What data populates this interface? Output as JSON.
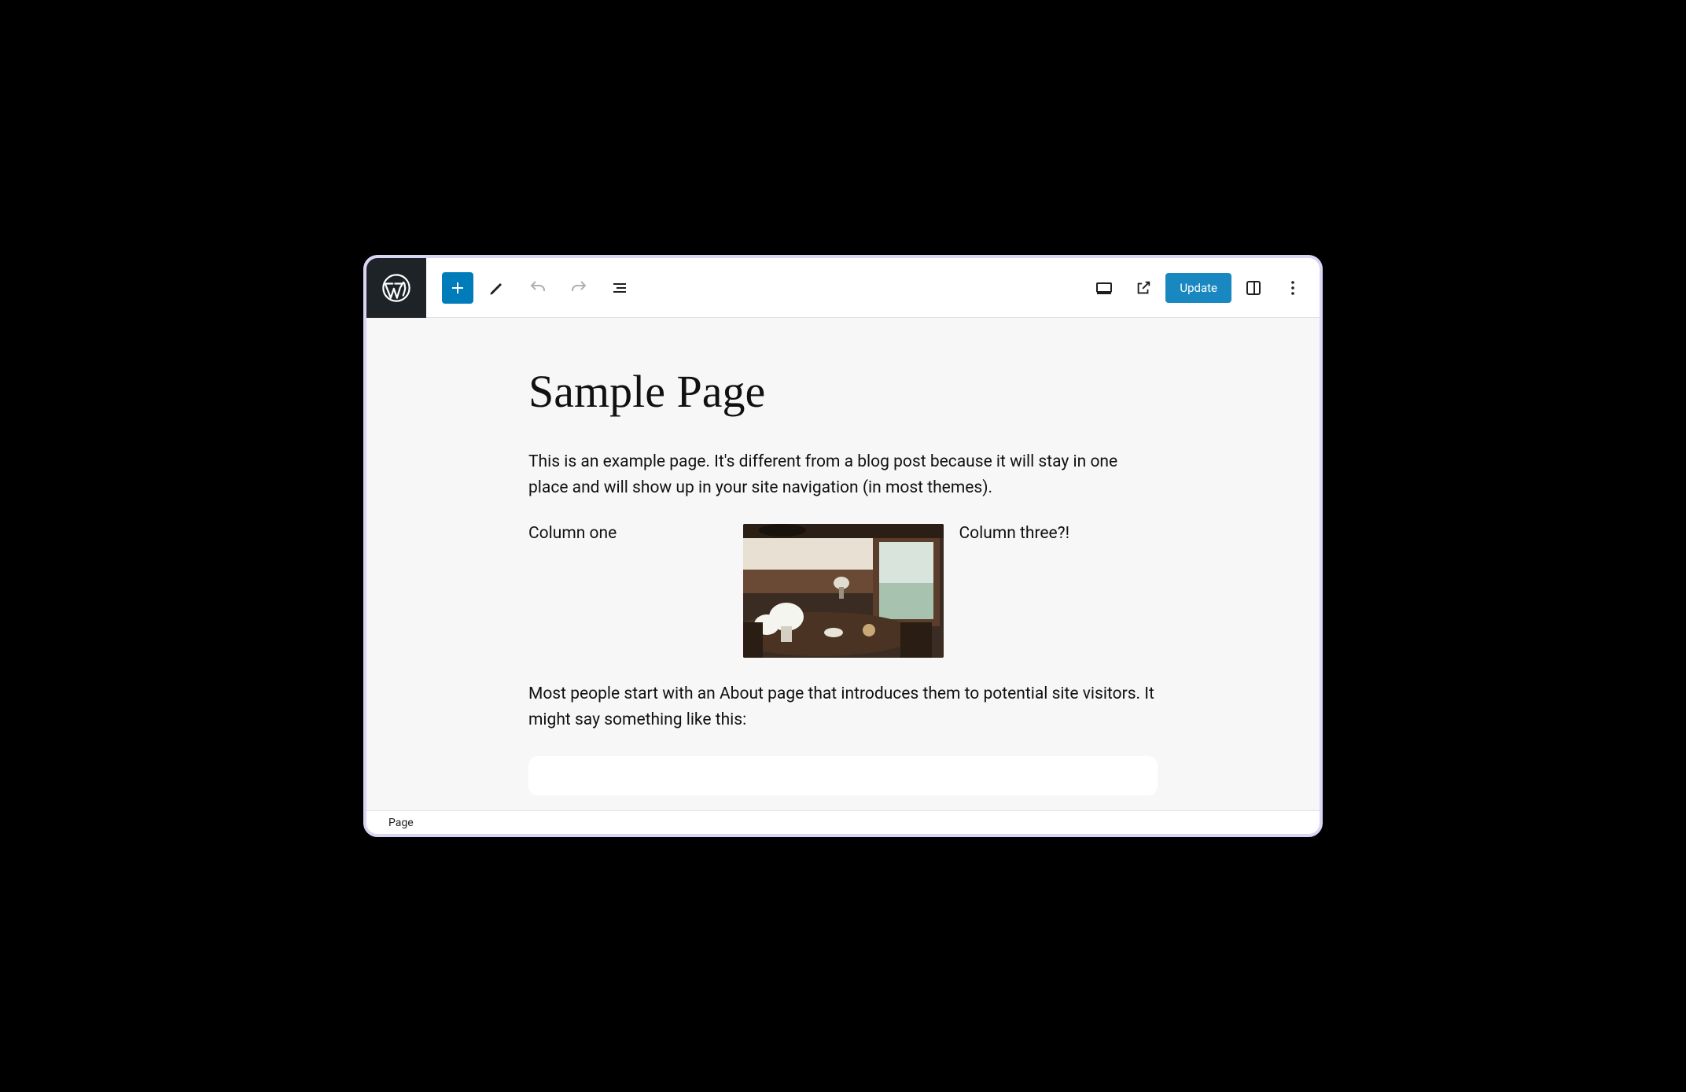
{
  "toolbar": {
    "update_label": "Update"
  },
  "content": {
    "title": "Sample Page",
    "intro": "This is an example page. It's different from a blog post because it will stay in one place and will show up in your site navigation (in most themes).",
    "columns": {
      "col1": "Column one",
      "col3": "Column three?!"
    },
    "about": "Most people start with an About page that introduces them to potential site visitors. It might say something like this:"
  },
  "breadcrumb": {
    "type": "Page"
  }
}
